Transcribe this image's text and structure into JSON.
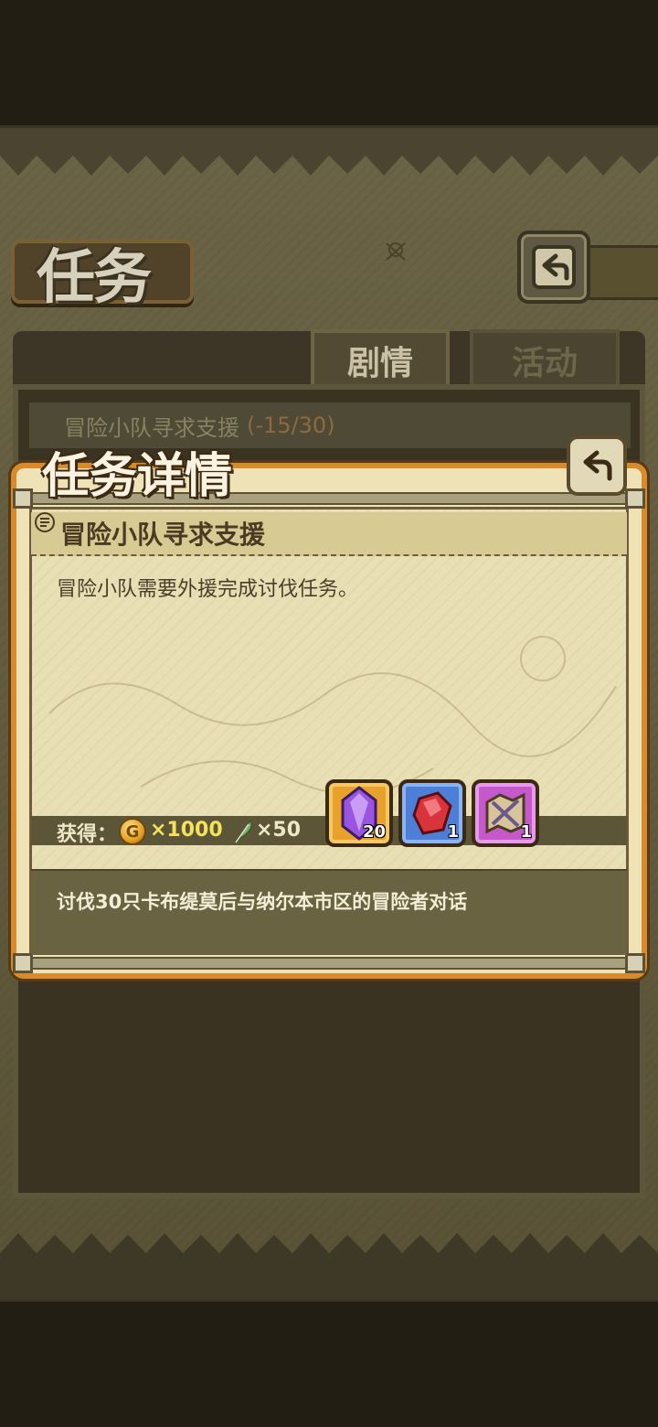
{
  "screen": {
    "title": "任务",
    "tabs": [
      {
        "label": "剧情",
        "active": true
      },
      {
        "label": "活动",
        "active": false
      }
    ]
  },
  "quest_list": {
    "items": [
      {
        "title": "冒险小队寻求支援",
        "progress": "(-15/30)"
      }
    ]
  },
  "detail_modal": {
    "title": "任务详情",
    "quest_name": "冒险小队寻求支援",
    "description": "冒险小队需要外援完成讨伐任务。",
    "reward_label": "获得：",
    "gold": {
      "icon_letter": "G",
      "amount": "×1000"
    },
    "feather": {
      "amount": "×50"
    },
    "items": [
      {
        "icon": "purple-crystal-icon",
        "count": "20"
      },
      {
        "icon": "red-gem-icon",
        "count": "1"
      },
      {
        "icon": "treasure-map-icon",
        "count": "1"
      }
    ],
    "objective": "讨伐30只卡布缇莫后与纳尔本市区的冒险者对话"
  },
  "colors": {
    "modal_border": "#d88b2c",
    "gold_text": "#f3e25c",
    "progress_text": "#8d6a3f"
  }
}
